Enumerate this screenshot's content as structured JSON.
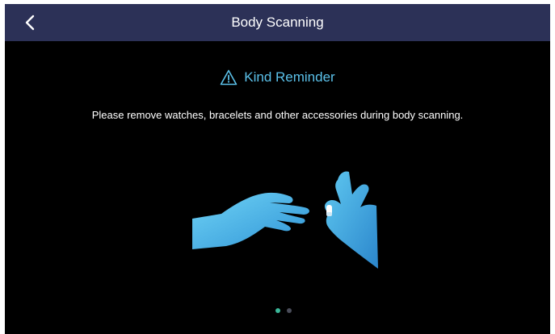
{
  "header": {
    "title": "Body Scanning",
    "back_icon": "chevron-left-icon"
  },
  "reminder": {
    "icon": "warning-triangle-icon",
    "title": "Kind Reminder",
    "message": "Please remove watches, bracelets and other accessories during body scanning."
  },
  "illustration": {
    "icon": "hands-removing-ring-icon"
  },
  "pager": {
    "page_count": 2,
    "current_page": 1
  },
  "colors": {
    "header_bg": "#2c3157",
    "screen_bg": "#000000",
    "accent": "#5bc1ea",
    "dot_active": "#3bb89a",
    "dot_inactive": "#4a4d5a"
  }
}
